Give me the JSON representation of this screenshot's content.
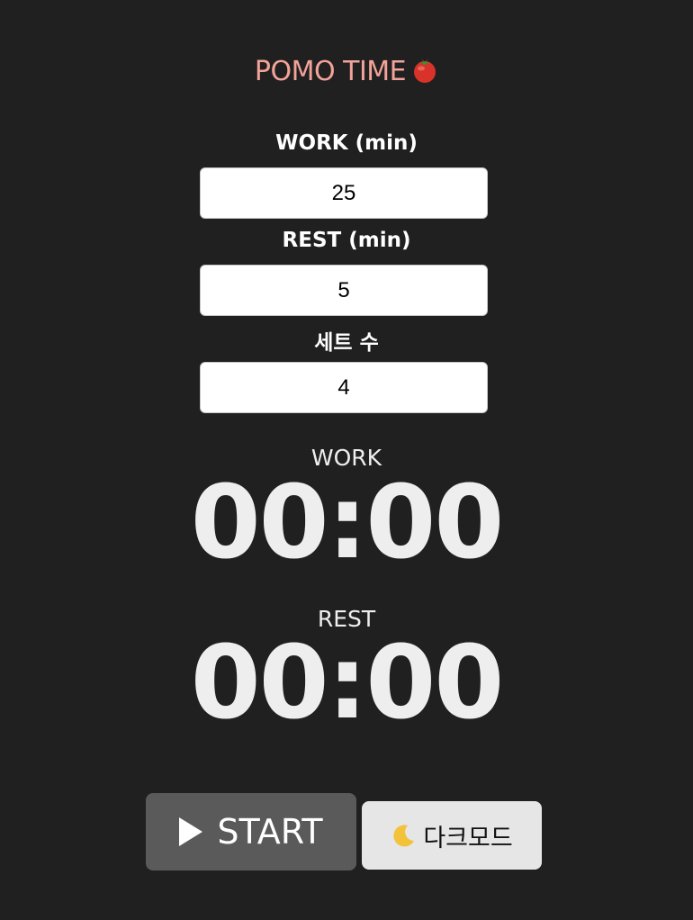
{
  "app": {
    "title": "POMO TIME",
    "title_icon": "tomato-icon",
    "accent_color": "#f2a39a"
  },
  "settings": {
    "work": {
      "label": "WORK (min)",
      "value": "25"
    },
    "rest": {
      "label": "REST (min)",
      "value": "5"
    },
    "sets": {
      "label": "세트 수",
      "value": "4"
    }
  },
  "timers": {
    "work": {
      "label": "WORK",
      "time": "00:00"
    },
    "rest": {
      "label": "REST",
      "time": "00:00"
    }
  },
  "controls": {
    "start": {
      "label": "START",
      "icon": "play-icon"
    },
    "dark_mode": {
      "label": "다크모드",
      "icon": "moon-icon"
    }
  }
}
